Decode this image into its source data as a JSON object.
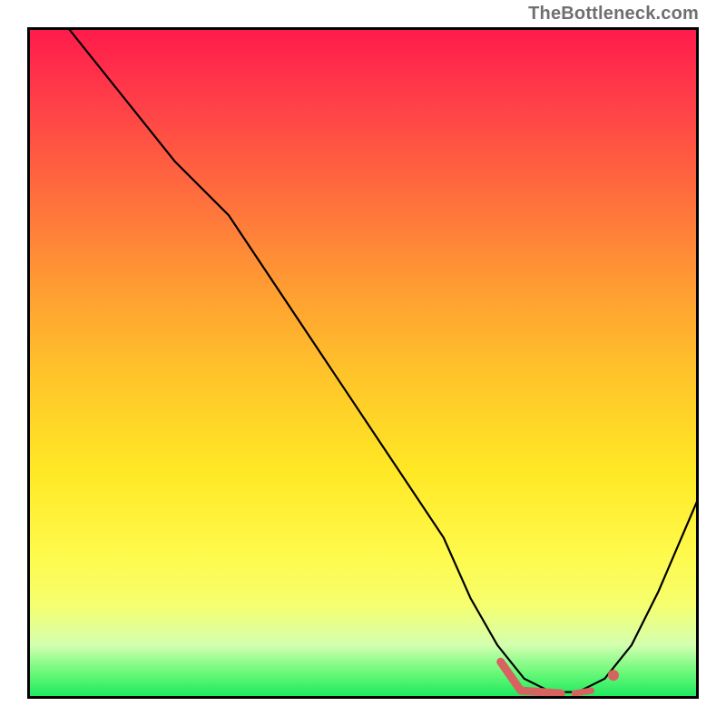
{
  "attribution": "TheBottleneck.com",
  "chart_data": {
    "type": "line",
    "title": "",
    "xlabel": "",
    "ylabel": "",
    "xlim": [
      0,
      100
    ],
    "ylim": [
      0,
      100
    ],
    "grid": false,
    "legend": false,
    "background": "red-yellow-green vertical gradient",
    "series": [
      {
        "name": "bottleneck-curve",
        "color": "#000000",
        "x": [
          6,
          14,
          22,
          30,
          38,
          46,
          54,
          62,
          66,
          70,
          74,
          78,
          82,
          86,
          90,
          94,
          100
        ],
        "y": [
          100,
          90,
          80,
          72,
          60,
          48,
          36,
          24,
          15,
          8,
          3,
          1,
          1,
          3,
          8,
          16,
          30
        ]
      }
    ],
    "markers": [
      {
        "name": "highlight-segment-left",
        "type": "line",
        "color": "#d6635f",
        "width": 9,
        "x": [
          70.5,
          73.5,
          79.5
        ],
        "y": [
          5.5,
          1.2,
          0.8
        ]
      },
      {
        "name": "highlight-dash",
        "type": "line",
        "color": "#d6635f",
        "width": 7,
        "x": [
          81.5,
          84.0
        ],
        "y": [
          0.8,
          1.2
        ]
      },
      {
        "name": "highlight-dot",
        "type": "point",
        "color": "#d6635f",
        "r": 6,
        "x": 87.3,
        "y": 3.5
      }
    ]
  }
}
